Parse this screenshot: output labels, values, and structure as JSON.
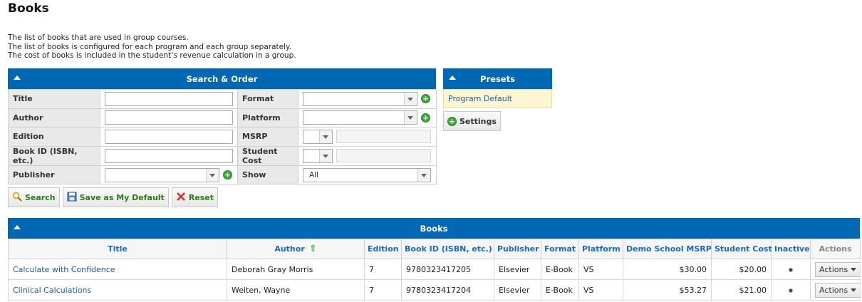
{
  "page": {
    "title": "Books",
    "intro": [
      "The list of books that are used in group courses.",
      "The list of books is configured for each program and each group separately.",
      "The cost of books is included in the student’s revenue calculation in a group."
    ]
  },
  "search": {
    "header": "Search & Order",
    "title_label": "Title",
    "author_label": "Author",
    "edition_label": "Edition",
    "bookid_label": "Book ID (ISBN, etc.)",
    "publisher_label": "Publisher",
    "format_label": "Format",
    "platform_label": "Platform",
    "msrp_label": "MSRP",
    "student_cost_label": "Student Cost",
    "show_label": "Show",
    "show_value": "All",
    "buttons": {
      "search": "Search",
      "save_default": "Save as My Default",
      "reset": "Reset"
    }
  },
  "presets": {
    "header": "Presets",
    "items": [
      "Program Default"
    ],
    "settings_label": "Settings"
  },
  "books": {
    "header": "Books",
    "columns": [
      "Title",
      "Author",
      "Edition",
      "Book ID (ISBN, etc.)",
      "Publisher",
      "Format",
      "Platform",
      "Demo School MSRP",
      "Student Cost",
      "Inactive",
      "Actions"
    ],
    "rows": [
      {
        "title": "Calculate with Confidence",
        "author": "Deborah Gray Morris",
        "edition": "7",
        "book_id": "9780323417205",
        "publisher": "Elsevier",
        "format": "E-Book",
        "platform": "VS",
        "msrp": "$30.00",
        "student_cost": "$20.00",
        "actions": "Actions"
      },
      {
        "title": "Clinical Calculations",
        "author": "Weiten, Wayne",
        "edition": "7",
        "book_id": "9780323417204",
        "publisher": "Elsevier",
        "format": "E-Book",
        "platform": "VS",
        "msrp": "$53.27",
        "student_cost": "$21.00",
        "actions": "Actions"
      }
    ]
  },
  "colors": {
    "header_blue": "#0068b3",
    "link_blue": "#1f5ea8",
    "button_green": "#2a7a1a",
    "preset_bg": "#fcf6d2"
  }
}
